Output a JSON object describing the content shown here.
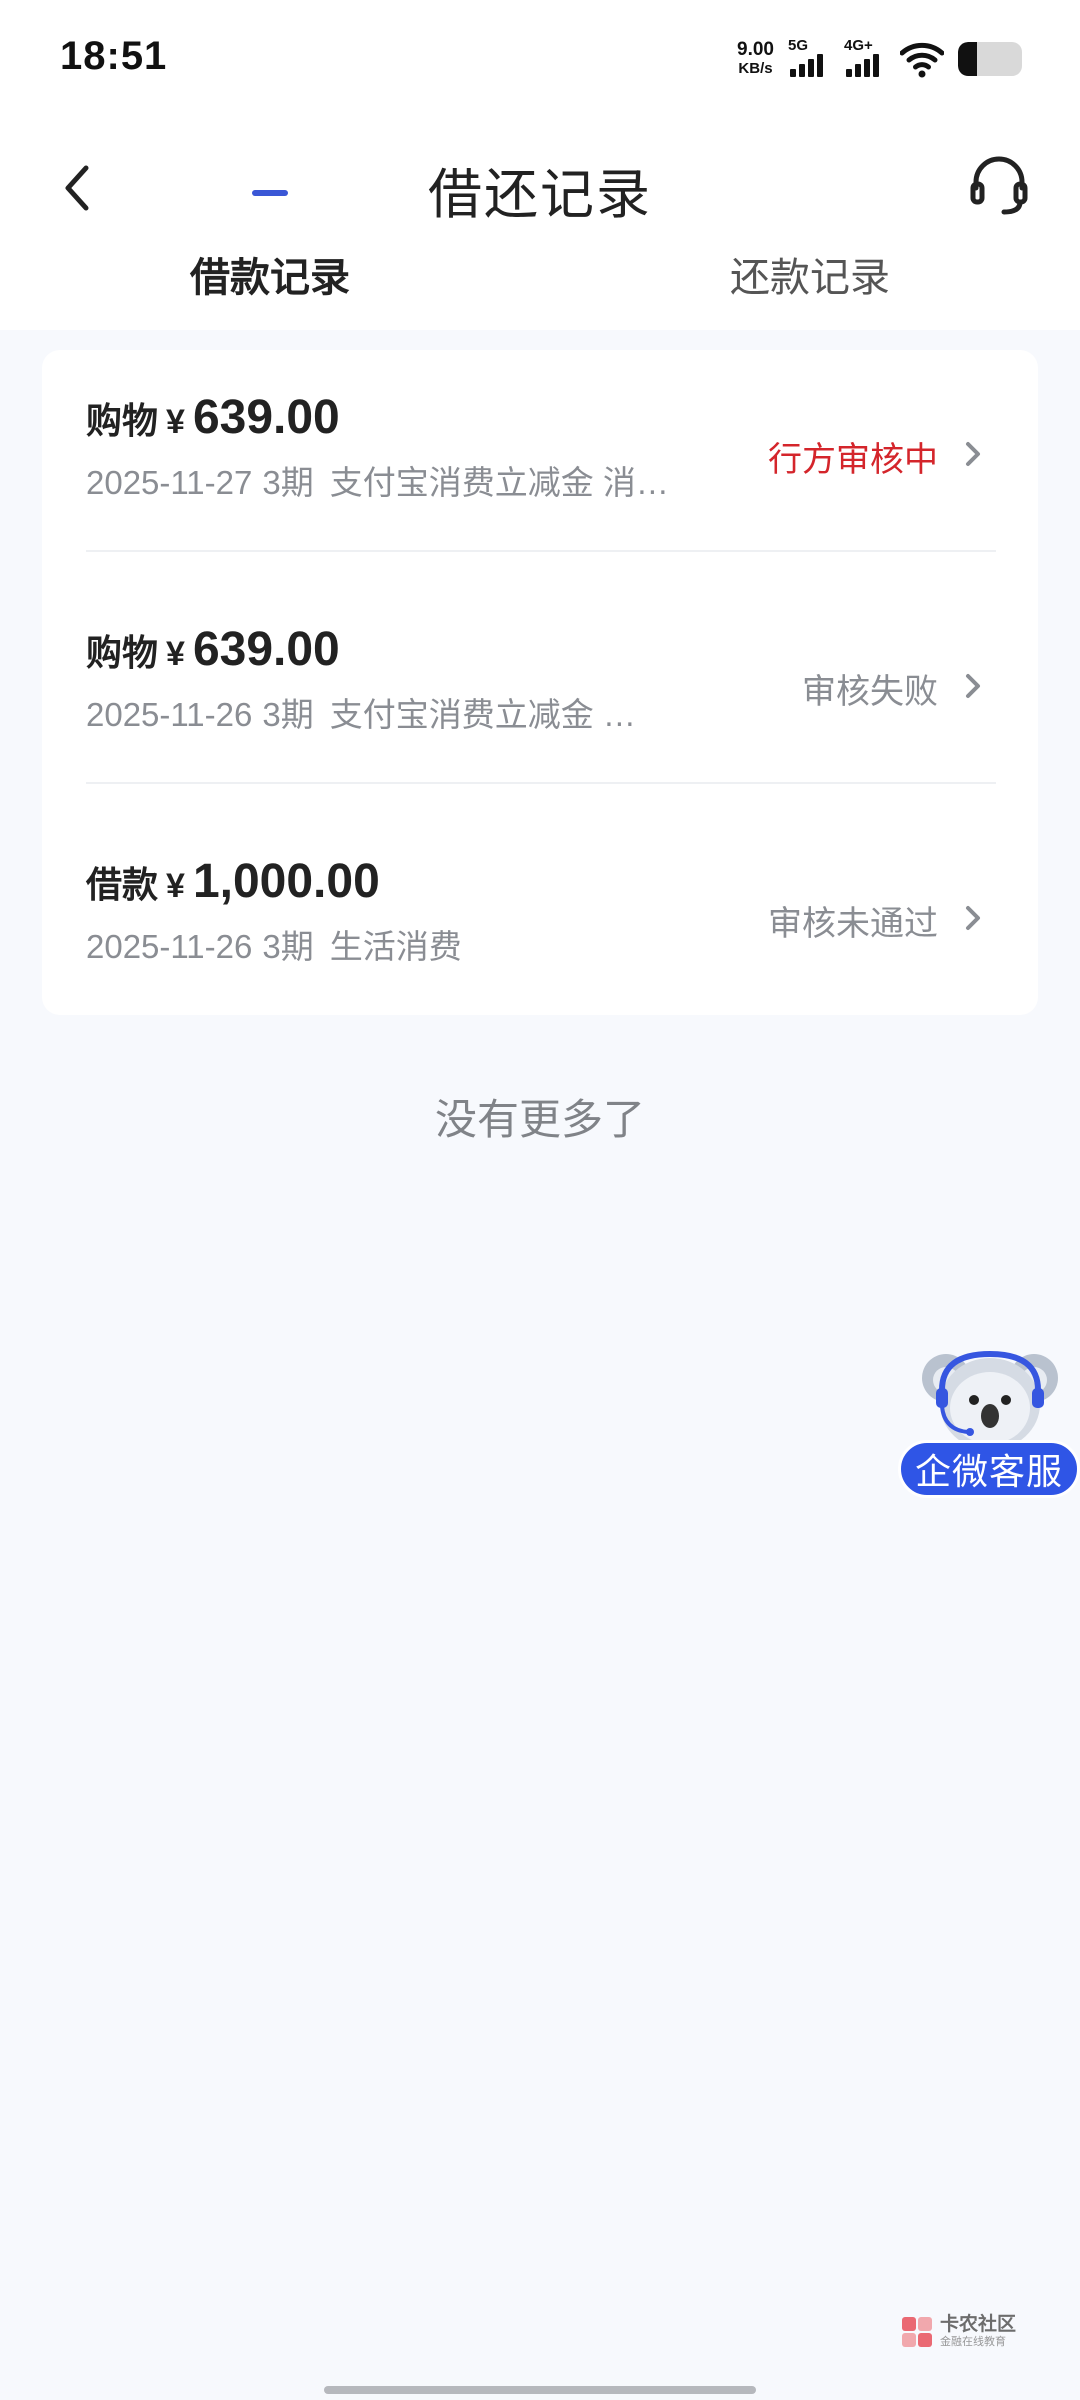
{
  "status_bar": {
    "time": "18:51",
    "net_speed_value": "9.00",
    "net_speed_unit": "KB/s",
    "sim1_label": "5G",
    "sim2_label": "4G+",
    "battery_level": 0.3
  },
  "header": {
    "title": "借还记录",
    "back_icon": "chevron-left-icon",
    "service_icon": "headset-icon"
  },
  "tabs": [
    {
      "label": "借款记录",
      "active": true
    },
    {
      "label": "还款记录",
      "active": false
    }
  ],
  "records": [
    {
      "type": "购物",
      "currency": "¥",
      "amount": "639.00",
      "date": "2025-11-27",
      "term": "3期",
      "note": "支付宝消费立减金 消…",
      "status": "行方审核中",
      "status_color": "#d4252b"
    },
    {
      "type": "购物",
      "currency": "¥",
      "amount": "639.00",
      "date": "2025-11-26",
      "term": "3期",
      "note": "支付宝消费立减金 …",
      "status": "审核失败",
      "status_color": "#8a8d93"
    },
    {
      "type": "借款",
      "currency": "¥",
      "amount": "1,000.00",
      "date": "2025-11-26",
      "term": "3期",
      "note": "生活消费",
      "status": "审核未通过",
      "status_color": "#8a8d93"
    }
  ],
  "footer_text": "没有更多了",
  "float_service": {
    "label": "企微客服",
    "icon": "koala-mascot-icon"
  },
  "watermark": {
    "main": "卡农社区",
    "sub": "金融在线教育"
  },
  "colors": {
    "accent": "#3a57d6",
    "status_red": "#d4252b",
    "float_blue": "#2f55e6",
    "background": "#f7f9fd"
  }
}
